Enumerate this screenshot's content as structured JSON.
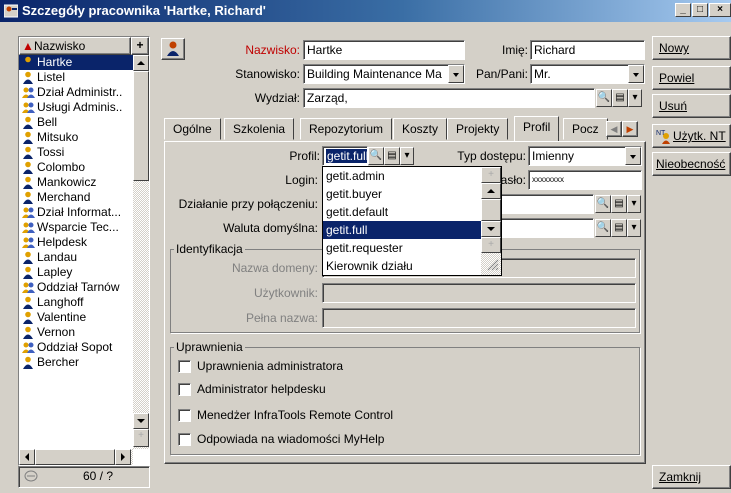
{
  "window": {
    "title": "Szczegóły pracownika 'Hartke, Richard'"
  },
  "left_list": {
    "header": "Nazwisko",
    "header_button": "+",
    "items": [
      {
        "label": "Hartke",
        "type": "person",
        "selected": true
      },
      {
        "label": "Listel",
        "type": "person"
      },
      {
        "label": "Dział Administr..",
        "type": "group"
      },
      {
        "label": "Usługi Adminis..",
        "type": "group"
      },
      {
        "label": "Bell",
        "type": "person"
      },
      {
        "label": "Mitsuko",
        "type": "person"
      },
      {
        "label": "Tossi",
        "type": "person"
      },
      {
        "label": "Colombo",
        "type": "person"
      },
      {
        "label": "Mankowicz",
        "type": "person"
      },
      {
        "label": "Merchand",
        "type": "person"
      },
      {
        "label": "Dział Informat...",
        "type": "group"
      },
      {
        "label": "Wsparcie Tec...",
        "type": "group"
      },
      {
        "label": "Helpdesk",
        "type": "group"
      },
      {
        "label": "Landau",
        "type": "person"
      },
      {
        "label": "Lapley",
        "type": "person"
      },
      {
        "label": "Oddział Tarnów",
        "type": "group"
      },
      {
        "label": "Langhoff",
        "type": "person"
      },
      {
        "label": "Valentine",
        "type": "person"
      },
      {
        "label": "Vernon",
        "type": "person"
      },
      {
        "label": "Oddział Sopot",
        "type": "group"
      },
      {
        "label": "Bercher",
        "type": "person"
      }
    ],
    "counter": "60 / ?"
  },
  "header": {
    "nazwisko_label": "Nazwisko:",
    "nazwisko_value": "Hartke",
    "imie_label": "Imię:",
    "imie_value": "Richard",
    "stanowisko_label": "Stanowisko:",
    "stanowisko_value": "Building Maintenance Ma",
    "panpani_label": "Pan/Pani:",
    "panpani_value": "Mr.",
    "wydzial_label": "Wydział:",
    "wydzial_value": "Zarząd,"
  },
  "tabs": [
    "Ogólne",
    "Szkolenia",
    "Repozytorium",
    "Koszty",
    "Projekty",
    "Profil",
    "Pocz"
  ],
  "active_tab": "Profil",
  "profil": {
    "profil_label": "Profil:",
    "profil_value": "getit.full",
    "typ_label": "Typ dostępu:",
    "typ_value": "Imienny",
    "login_label": "Login:",
    "haslo_label": "asło:",
    "haslo_value": "xxxxxxxx",
    "dzialanie_label": "Działanie przy połączeniu:",
    "waluta_label": "Waluta domyślna:",
    "identyfikacja_label": "Identyfikacja",
    "nazwa_domeny_label": "Nazwa domeny:",
    "uzytkownik_label": "Użytkownik:",
    "pelna_nazwa_label": "Pełna nazwa:",
    "uprawnienia_label": "Uprawnienia",
    "checkboxes": [
      "Uprawnienia administratora",
      "Administrator helpdesku",
      "Menedżer InfraTools Remote Control",
      "Odpowiada na wiadomości MyHelp"
    ]
  },
  "dropdown": {
    "options": [
      "getit.admin",
      "getit.buyer",
      "getit.default",
      "getit.full",
      "getit.requester",
      "Kierownik działu"
    ],
    "selected": "getit.full"
  },
  "buttons": {
    "nowy": "Nowy",
    "powiel": "Powiel",
    "usun": "Usuń",
    "uzytk": "Użytk. NT",
    "nieobecnosc": "Nieobecność",
    "zamknij": "Zamknij"
  },
  "colors": {
    "title_bar": "#0a246a",
    "selection": "#0a246a",
    "required_label": "#c00000"
  }
}
